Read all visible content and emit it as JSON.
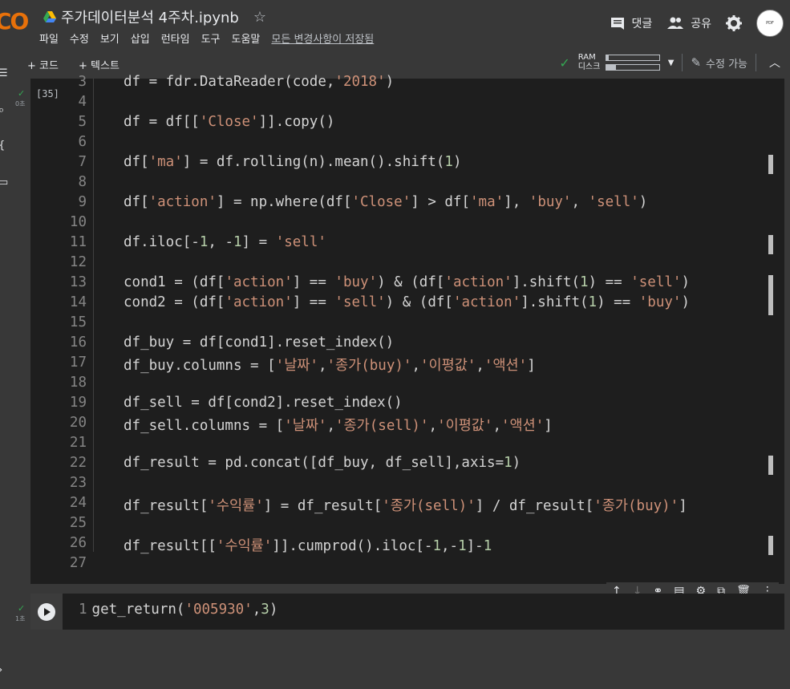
{
  "app": {
    "logo_text": "CO",
    "notebook_title": "주가데이터분석 4주차.ipynb",
    "star_icon": "star-outline-icon"
  },
  "menu": [
    "파일",
    "수정",
    "보기",
    "삽입",
    "런타임",
    "도구",
    "도움말"
  ],
  "save_status": "모든 변경사항이 저장됨",
  "header_right": {
    "comments_label": "댓글",
    "share_label": "공유",
    "avatar_text": "PDF"
  },
  "toolbar": {
    "add_code": "+ 코드",
    "add_text": "+ 텍스트",
    "ram_label": "RAM",
    "disk_label": "디스크",
    "ram_fill": 0.05,
    "disk_fill": 0.18,
    "edit_mode": "수정 가능"
  },
  "cell1": {
    "exec_count": "[35]",
    "time": "0초",
    "lines": [
      {
        "n": "3",
        "code": "df = fdr.DataReader(code,'2018')"
      },
      {
        "n": "4",
        "code": ""
      },
      {
        "n": "5",
        "code": "df = df[['Close']].copy()"
      },
      {
        "n": "6",
        "code": ""
      },
      {
        "n": "7",
        "code": "df['ma'] = df.rolling(n).mean().shift(1)"
      },
      {
        "n": "8",
        "code": ""
      },
      {
        "n": "9",
        "code": "df['action'] = np.where(df['Close'] > df['ma'], 'buy', 'sell')"
      },
      {
        "n": "10",
        "code": ""
      },
      {
        "n": "11",
        "code": "df.iloc[-1, -1] = 'sell'"
      },
      {
        "n": "12",
        "code": ""
      },
      {
        "n": "13",
        "code": "cond1 = (df['action'] == 'buy') & (df['action'].shift(1) == 'sell')"
      },
      {
        "n": "14",
        "code": "cond2 = (df['action'] == 'sell') & (df['action'].shift(1) == 'buy')"
      },
      {
        "n": "15",
        "code": ""
      },
      {
        "n": "16",
        "code": "df_buy = df[cond1].reset_index()"
      },
      {
        "n": "17",
        "code": "df_buy.columns = ['날짜','종가(buy)','이평값','액션']"
      },
      {
        "n": "18",
        "code": ""
      },
      {
        "n": "19",
        "code": "df_sell = df[cond2].reset_index()"
      },
      {
        "n": "20",
        "code": "df_sell.columns = ['날짜','종가(sell)','이평값','액션']"
      },
      {
        "n": "21",
        "code": ""
      },
      {
        "n": "22",
        "code": "df_result = pd.concat([df_buy, df_sell],axis=1)"
      },
      {
        "n": "23",
        "code": ""
      },
      {
        "n": "24",
        "code": "df_result['수익률'] = df_result['종가(sell)'] / df_result['종가(buy)']"
      },
      {
        "n": "25",
        "code": ""
      },
      {
        "n": "26",
        "code": "df_result[['수익률']].cumprod().iloc[-1,-1]-1"
      },
      {
        "n": "27",
        "code": ""
      }
    ]
  },
  "cell2": {
    "time": "1초",
    "line_number": "1",
    "code": "get_return('005930',3)"
  }
}
